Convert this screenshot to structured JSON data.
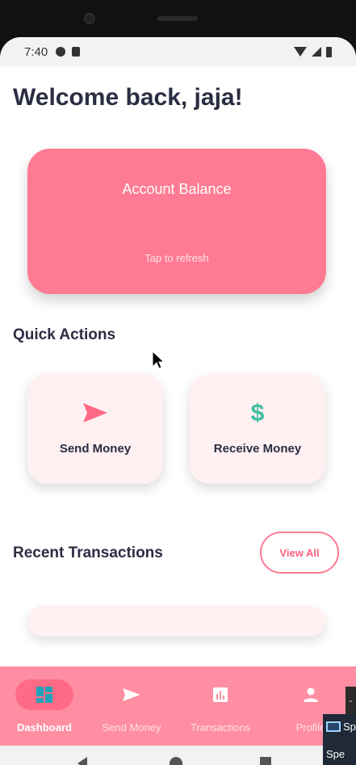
{
  "status_bar": {
    "time": "7:40",
    "icons": [
      "notification-icon",
      "sd-card-icon",
      "wifi-icon",
      "signal-icon",
      "battery-icon"
    ]
  },
  "header": {
    "welcome": "Welcome back, jaja!"
  },
  "balance_card": {
    "title": "Account Balance",
    "hint": "Tap to refresh",
    "color": "#ff7b93"
  },
  "quick_actions": {
    "title": "Quick Actions",
    "items": [
      {
        "label": "Send Money",
        "icon": "send-icon",
        "icon_color": "#ff6b86"
      },
      {
        "label": "Receive Money",
        "icon": "dollar-icon",
        "icon_glyph": "$",
        "icon_color": "#3dbfa0"
      }
    ]
  },
  "recent_transactions": {
    "title": "Recent Transactions",
    "view_all_label": "View All"
  },
  "bottom_nav": {
    "items": [
      {
        "label": "Dashboard",
        "icon": "dashboard-icon",
        "active": true
      },
      {
        "label": "Send Money",
        "icon": "send-icon",
        "active": false
      },
      {
        "label": "Transactions",
        "icon": "chart-icon",
        "active": false
      },
      {
        "label": "Profile",
        "icon": "person-icon",
        "active": false
      }
    ],
    "color": "#ff8ea2",
    "active_color": "#ff6b86"
  },
  "system_overlay": {
    "button_glyph": "-",
    "line1": "Sp",
    "line2": "Spe"
  }
}
